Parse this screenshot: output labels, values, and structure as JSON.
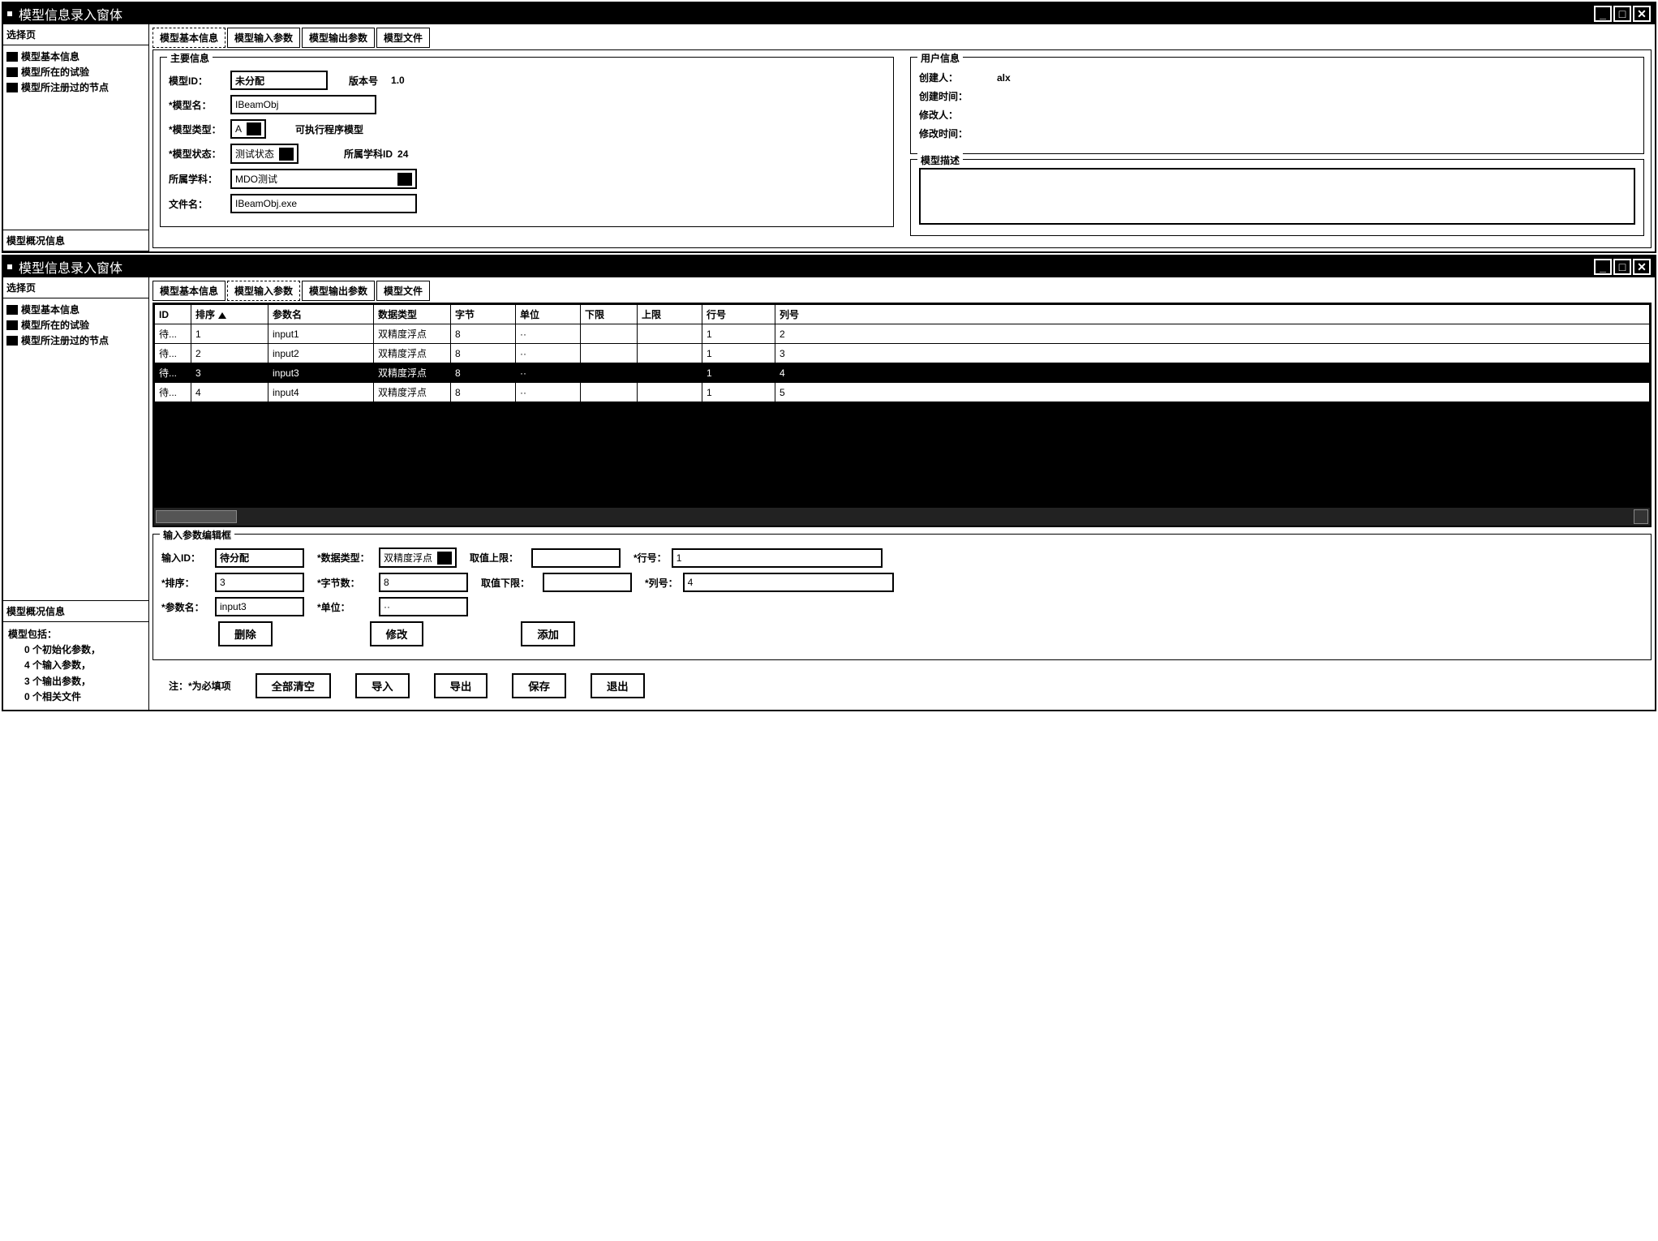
{
  "window_title": "模型信息录入窗体",
  "sidebar": {
    "header": "选择页",
    "items": [
      "模型基本信息",
      "模型所在的试验",
      "模型所注册过的节点"
    ],
    "status_header": "模型概况信息",
    "status": {
      "line0": "模型包括：",
      "init": "0 个初始化参数，",
      "inputs": "4 个输入参数，",
      "outputs": "3 个输出参数，",
      "files": "0 个相关文件"
    }
  },
  "tabs": [
    "模型基本信息",
    "模型输入参数",
    "模型输出参数",
    "模型文件"
  ],
  "basic": {
    "main_info_legend": "主要信息",
    "user_info_legend": "用户信息",
    "desc_legend": "模型描述",
    "labels": {
      "model_id": "模型ID：",
      "version": "版本号",
      "model_name": "*模型名：",
      "model_type": "*模型类型：",
      "exe_desc": "可执行程序模型",
      "model_status": "*模型状态：",
      "subject_id": "所属学科ID",
      "subject": "所属学科：",
      "filename": "文件名：",
      "creator": "创建人：",
      "create_time": "创建时间：",
      "modifier": "修改人：",
      "modify_time": "修改时间："
    },
    "values": {
      "model_id": "未分配",
      "version": "1.0",
      "model_name": "IBeamObj",
      "model_type": "A",
      "model_status": "测试状态",
      "subject_id": "24",
      "subject": "MDO测试",
      "filename": "IBeamObj.exe",
      "creator": "alx",
      "create_time": "",
      "modifier": "",
      "modify_time": "",
      "description": ""
    }
  },
  "grid": {
    "headers": [
      "ID",
      "排序",
      "参数名",
      "数据类型",
      "字节",
      "单位",
      "下限",
      "上限",
      "行号",
      "列号"
    ],
    "rows": [
      {
        "id": "待...",
        "sort": "1",
        "name": "input1",
        "dtype": "双精度浮点",
        "bytes": "8",
        "unit": "··",
        "low": "",
        "high": "",
        "row": "1",
        "col": "2",
        "sel": false
      },
      {
        "id": "待...",
        "sort": "2",
        "name": "input2",
        "dtype": "双精度浮点",
        "bytes": "8",
        "unit": "··",
        "low": "",
        "high": "",
        "row": "1",
        "col": "3",
        "sel": false
      },
      {
        "id": "待...",
        "sort": "3",
        "name": "input3",
        "dtype": "双精度浮点",
        "bytes": "8",
        "unit": "··",
        "low": "",
        "high": "",
        "row": "1",
        "col": "4",
        "sel": true
      },
      {
        "id": "待...",
        "sort": "4",
        "name": "input4",
        "dtype": "双精度浮点",
        "bytes": "8",
        "unit": "··",
        "low": "",
        "high": "",
        "row": "1",
        "col": "5",
        "sel": false
      }
    ]
  },
  "editbox": {
    "legend": "输入参数编辑框",
    "labels": {
      "input_id": "输入ID：",
      "dtype": "*数据类型：",
      "upper": "取值上限：",
      "rownum": "*行号：",
      "sort": "*排序：",
      "bytes": "*字节数：",
      "lower": "取值下限：",
      "colnum": "*列号：",
      "pname": "*参数名：",
      "unit": "*单位："
    },
    "values": {
      "input_id": "待分配",
      "dtype": "双精度浮点",
      "upper": "",
      "rownum": "1",
      "sort": "3",
      "bytes": "8",
      "lower": "",
      "colnum": "4",
      "pname": "input3",
      "unit": "··"
    },
    "buttons": {
      "delete": "删除",
      "modify": "修改",
      "add": "添加"
    }
  },
  "footer": {
    "note": "注：*为必填项",
    "clear": "全部清空",
    "import": "导入",
    "export": "导出",
    "save": "保存",
    "exit": "退出"
  }
}
